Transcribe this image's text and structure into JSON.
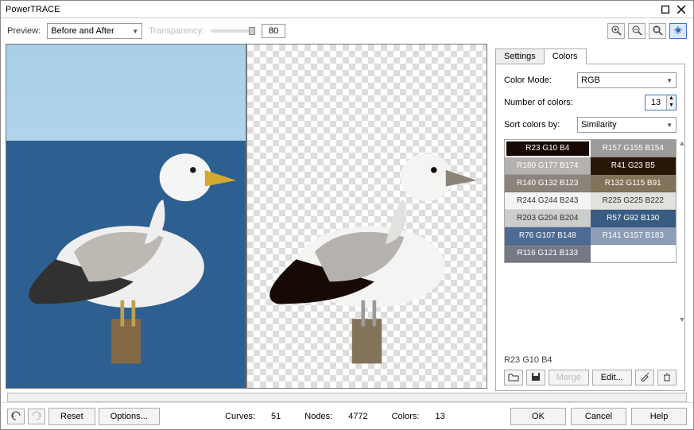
{
  "window": {
    "title": "PowerTRACE"
  },
  "toolbar": {
    "preview_label": "Preview:",
    "preview_mode": "Before and After",
    "transparency_label": "Transparency:",
    "transparency_value": "80"
  },
  "tabs": {
    "settings": "Settings",
    "colors": "Colors"
  },
  "colors_panel": {
    "color_mode_label": "Color Mode:",
    "color_mode_value": "RGB",
    "num_colors_label": "Number of colors:",
    "num_colors_value": "13",
    "sort_label": "Sort colors by:",
    "sort_value": "Similarity",
    "selected_swatch": "R23 G10 B4",
    "merge_label": "Merge",
    "edit_label": "Edit...",
    "swatches": [
      {
        "label": "R23 G10 B4",
        "bg": "#170a04",
        "light": false,
        "selected": true
      },
      {
        "label": "R157 G155 B154",
        "bg": "#9d9b9a",
        "light": false
      },
      {
        "label": "R180 G177 B174",
        "bg": "#b4b1ae",
        "light": false
      },
      {
        "label": "R41 G23 B5",
        "bg": "#291705",
        "light": false
      },
      {
        "label": "R140 G132 B123",
        "bg": "#8c847b",
        "light": false
      },
      {
        "label": "R132 G115 B91",
        "bg": "#84735b",
        "light": false
      },
      {
        "label": "R244 G244 B243",
        "bg": "#f4f4f3",
        "light": true
      },
      {
        "label": "R225 G225 B222",
        "bg": "#e1e1de",
        "light": true
      },
      {
        "label": "R203 G204 B204",
        "bg": "#cbcccc",
        "light": true
      },
      {
        "label": "R57 G92 B130",
        "bg": "#395c82",
        "light": false
      },
      {
        "label": "R76 G107 B148",
        "bg": "#4c6b94",
        "light": false
      },
      {
        "label": "R141 G157 B183",
        "bg": "#8d9db7",
        "light": false
      },
      {
        "label": "R116 G121 B133",
        "bg": "#747985",
        "light": false
      }
    ]
  },
  "status": {
    "reset": "Reset",
    "options": "Options...",
    "curves_label": "Curves:",
    "curves_value": "51",
    "nodes_label": "Nodes:",
    "nodes_value": "4772",
    "colors_label": "Colors:",
    "colors_value": "13",
    "ok": "OK",
    "cancel": "Cancel",
    "help": "Help"
  },
  "icons": {
    "zoom_in": "zoom-in-icon",
    "zoom_out": "zoom-out-icon",
    "zoom_fit": "zoom-fit-icon",
    "pan": "pan-icon",
    "undo": "undo-icon",
    "redo": "redo-icon",
    "open": "folder-open-icon",
    "save": "save-icon",
    "eyedrop": "eyedropper-icon",
    "trash": "trash-icon"
  }
}
